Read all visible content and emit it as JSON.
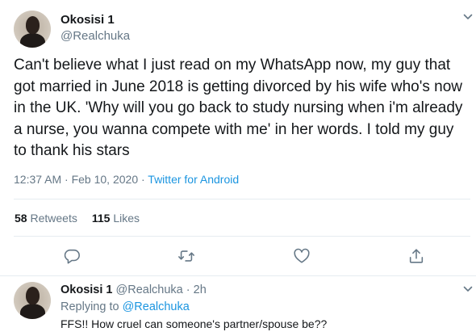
{
  "tweet": {
    "author_name": "Okosisi 1",
    "author_handle": "@Realchuka",
    "text": "Can't believe what I just read on my WhatsApp now, my guy that got married in June 2018 is getting divorced by his wife who's now in the UK. 'Why will you go back to study nursing when i'm already a nurse, you wanna compete with me' in her words. I told my guy to thank his stars",
    "timestamp": "12:37 AM · Feb 10, 2020 · ",
    "source": "Twitter for Android",
    "retweets_count": "58",
    "retweets_label": "Retweets",
    "likes_count": "115",
    "likes_label": "Likes"
  },
  "actions": {
    "icons": [
      "reply-icon",
      "retweet-icon",
      "like-icon",
      "share-icon"
    ]
  },
  "reply": {
    "author_name": "Okosisi 1",
    "author_handle": "@Realchuka",
    "separator": "·",
    "time": "2h",
    "replying_to_label": "Replying to",
    "replying_to_handle": "@Realchuka",
    "text": "FFS!! How cruel can someone's partner/spouse be??"
  },
  "colors": {
    "text_primary": "#14171a",
    "text_secondary": "#657786",
    "link": "#1b95e0",
    "divider": "#e6ecf0"
  }
}
